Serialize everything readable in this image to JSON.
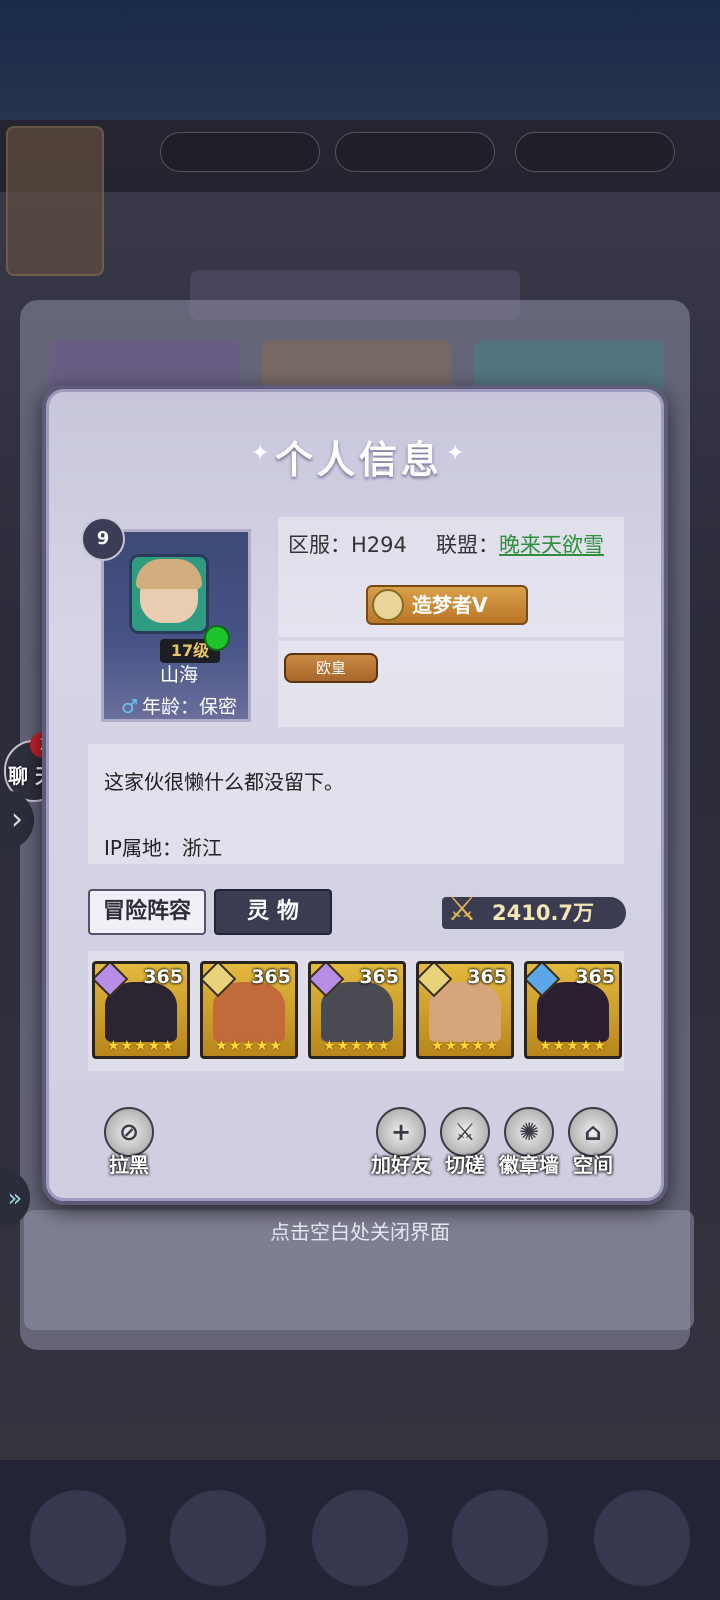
{
  "modal": {
    "title": "个人信息",
    "player": {
      "level": "9",
      "vip": "17级",
      "name": "山海",
      "age_line": "年龄：保密",
      "gender_symbol": "♂"
    },
    "server_label": "区服：H294",
    "alliance_prefix": "联盟：",
    "alliance_name": "晚来天欲雪",
    "title_badge": "造梦者V",
    "tag": "欧皇",
    "bio": "这家伙很懒什么都没留下。",
    "ip_location": "IP属地：浙江",
    "tabs": [
      {
        "label": "冒险阵容",
        "active": true
      },
      {
        "label": "灵 物",
        "active": false
      }
    ],
    "power": "2410.7万",
    "heroes": [
      {
        "level": "365",
        "stars": "★★★★★",
        "faction_color": "#b68ee6",
        "portrait_color": "#2b2531"
      },
      {
        "level": "365",
        "stars": "★★★★★",
        "faction_color": "#e7d27a",
        "portrait_color": "#c26a3a"
      },
      {
        "level": "365",
        "stars": "★★★★★",
        "faction_color": "#b68ee6",
        "portrait_color": "#4a4a52"
      },
      {
        "level": "365",
        "stars": "★★★★★",
        "faction_color": "#e7d27a",
        "portrait_color": "#d7a57c"
      },
      {
        "level": "365",
        "stars": "★★★★★",
        "faction_color": "#5da6e8",
        "portrait_color": "#2a2030"
      }
    ],
    "actions": {
      "block": "拉黑",
      "add_friend": "加好友",
      "duel": "切磋",
      "badge_wall": "徽章墙",
      "space": "空间"
    }
  },
  "chat": {
    "badge": "2",
    "label": "聊 天"
  },
  "close_hint": "点击空白处关闭界面",
  "colors": {
    "accent_gold": "#b87627",
    "online": "#1ec52a",
    "alliance_link": "#2f8f3d",
    "badge_red": "#c2202a"
  }
}
